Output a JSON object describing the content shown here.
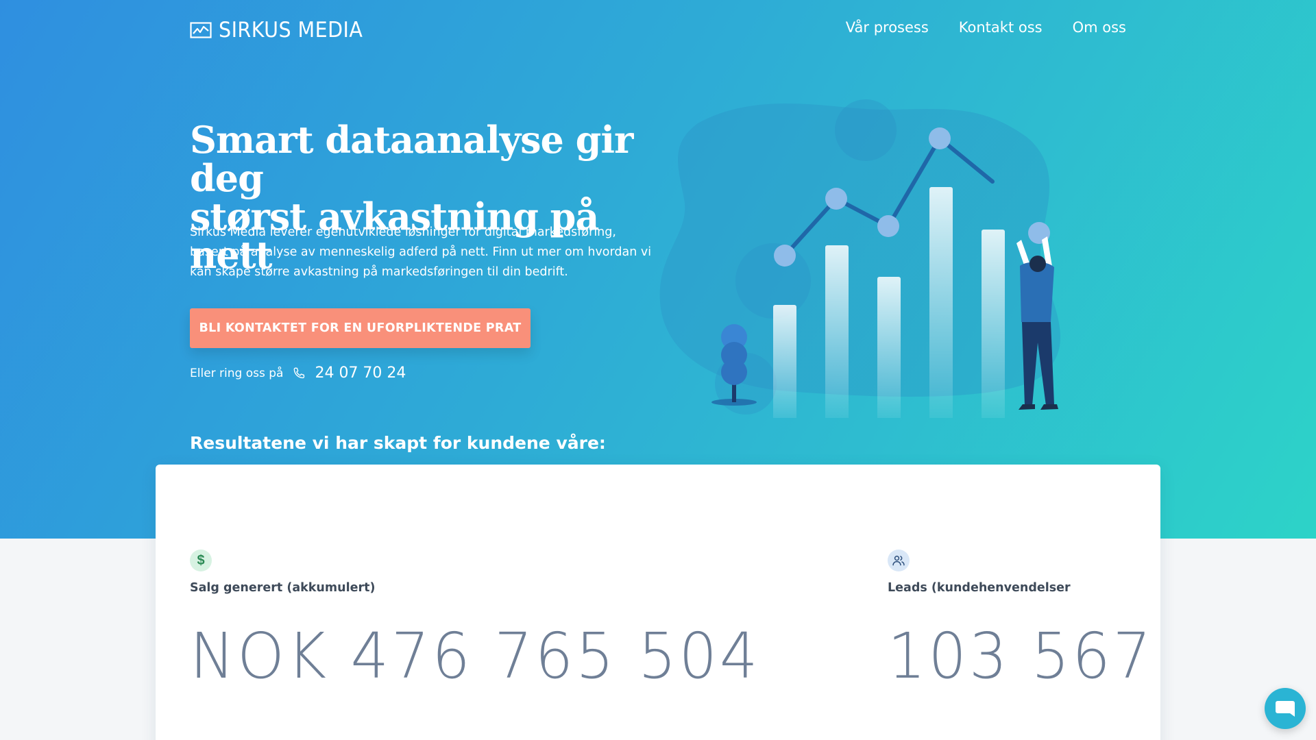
{
  "brand": {
    "name": "SIRKUS MEDIA",
    "logo_icon": "line-chart-icon"
  },
  "nav": {
    "items": [
      {
        "label": "Vår prosess"
      },
      {
        "label": "Kontakt oss"
      },
      {
        "label": "Om oss"
      }
    ]
  },
  "hero": {
    "headline_line1": "Smart dataanalyse gir deg",
    "headline_line2": "størst avkastning på nett",
    "lede": "Sirkus Media leverer egenutviklede løsninger for digital markedsføring, basert på analyse av menneskelig adferd på nett. Finn ut mer om hvordan vi kan skape større avkastning på markedsføringen til din bedrift.",
    "cta_label": "BLI KONTAKTET FOR EN UFORPLIKTENDE PRAT",
    "phone_label": "Eller ring oss på",
    "phone_icon": "phone-icon",
    "phone_number": "24 07 70 24"
  },
  "results": {
    "title": "Resultatene vi har skapt for kundene våre:",
    "stats": [
      {
        "icon": "dollar-icon",
        "label": "Salg generert (akkumulert)",
        "value": "NOK 476 765 504"
      },
      {
        "icon": "users-icon",
        "label": "Leads (kundehenvendelser",
        "value": "103 567"
      }
    ]
  },
  "colors": {
    "gradient_start": "#2f8fe0",
    "gradient_end": "#2dd3c8",
    "cta": "#f9907a",
    "stat_value": "#6f7f96"
  },
  "chat": {
    "icon": "chat-bubble-icon"
  }
}
